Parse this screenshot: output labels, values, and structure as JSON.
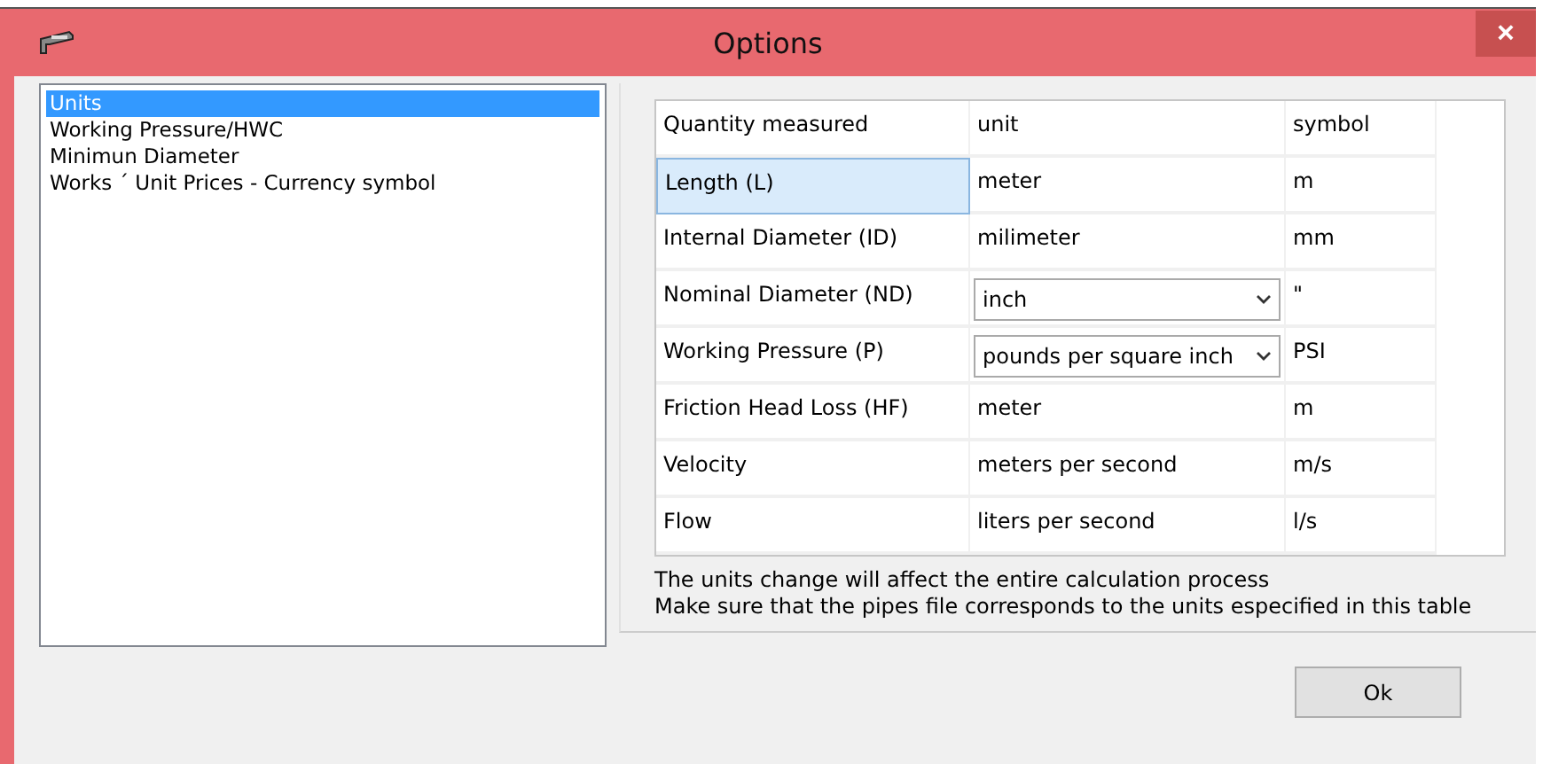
{
  "window": {
    "title": "Options",
    "close": "×"
  },
  "sidebar": {
    "items": [
      {
        "label": "Units",
        "selected": true
      },
      {
        "label": "Working Pressure/HWC",
        "selected": false
      },
      {
        "label": "Minimun Diameter",
        "selected": false
      },
      {
        "label": "Works ´ Unit Prices - Currency symbol",
        "selected": false
      }
    ]
  },
  "table": {
    "columns": [
      "Quantity measured",
      "unit",
      "symbol"
    ],
    "rows": [
      {
        "quantity": "Length (L)",
        "unit": {
          "kind": "text",
          "value": "meter"
        },
        "symbol": "m",
        "selected": true
      },
      {
        "quantity": "Internal Diameter (ID)",
        "unit": {
          "kind": "text",
          "value": "milimeter"
        },
        "symbol": "mm",
        "selected": false
      },
      {
        "quantity": "Nominal Diameter (ND)",
        "unit": {
          "kind": "dropdown",
          "value": "inch"
        },
        "symbol": "\"",
        "selected": false
      },
      {
        "quantity": "Working Pressure (P)",
        "unit": {
          "kind": "dropdown",
          "value": "pounds per square inch"
        },
        "symbol": "PSI",
        "selected": false
      },
      {
        "quantity": "Friction Head Loss (HF)",
        "unit": {
          "kind": "text",
          "value": "meter"
        },
        "symbol": "m",
        "selected": false
      },
      {
        "quantity": "Velocity",
        "unit": {
          "kind": "text",
          "value": "meters per second"
        },
        "symbol": "m/s",
        "selected": false
      },
      {
        "quantity": "Flow",
        "unit": {
          "kind": "text",
          "value": "liters per second"
        },
        "symbol": "l/s",
        "selected": false
      }
    ]
  },
  "notes": [
    "The units change will affect the entire calculation process",
    "Make sure that the pipes file corresponds to the units especified in this table"
  ],
  "buttons": [
    "Ok"
  ]
}
